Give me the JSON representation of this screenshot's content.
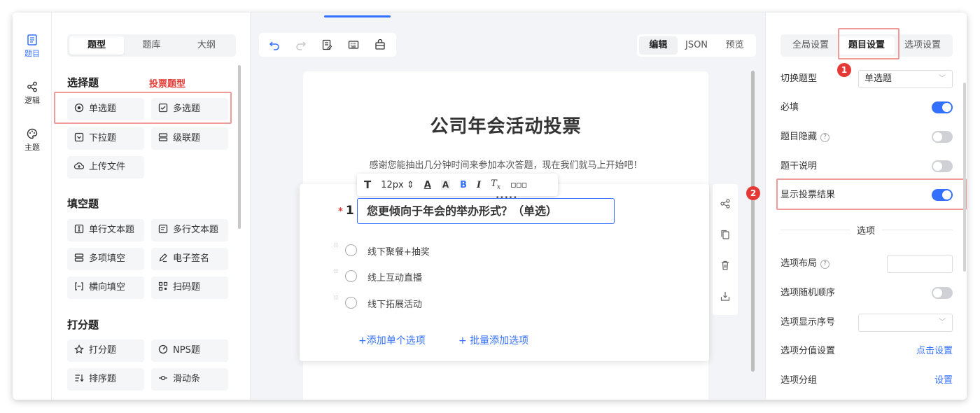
{
  "rail": [
    {
      "label": "题目",
      "icon": "document-icon",
      "active": true
    },
    {
      "label": "逻辑",
      "icon": "share-icon"
    },
    {
      "label": "主题",
      "icon": "palette-icon"
    }
  ],
  "left": {
    "tabs": [
      "题型",
      "题库",
      "大纲"
    ],
    "sections": {
      "choice": "选择题",
      "fill": "填空题",
      "score": "打分题"
    },
    "vote_label": "投票题型",
    "choice_items": [
      "单选题",
      "多选题",
      "下拉题",
      "级联题",
      "上传文件"
    ],
    "fill_items": [
      "单行文本题",
      "多行文本题",
      "多项填空",
      "电子签名",
      "横向填空",
      "扫码题"
    ],
    "score_items": [
      "打分题",
      "NPS题",
      "排序题",
      "滑动条"
    ]
  },
  "center": {
    "modes": [
      "编辑",
      "JSON",
      "预览"
    ],
    "survey_title": "公司年会活动投票",
    "survey_desc": "感谢您能抽出几分钟时间来参加本次答题，现在我们就马上开始吧！",
    "rt": {
      "font_size": "12px"
    },
    "question": {
      "number": "1",
      "title": "您更倾向于年会的举办形式？（单选）"
    },
    "options": [
      "线下聚餐+抽奖",
      "线上互动直播",
      "线下拓展活动"
    ],
    "add_single": "+添加单个选项",
    "add_batch": "+ 批量添加选项"
  },
  "right": {
    "tabs": [
      "全局设置",
      "题目设置",
      "选项设置"
    ],
    "switch_type": {
      "label": "切换题型",
      "value": "单选题"
    },
    "required": "必填",
    "hidden": "题目隐藏",
    "desc": "题干说明",
    "show_vote": "显示投票结果",
    "options_divider": "选项",
    "layout": "选项布局",
    "random": "选项随机顺序",
    "seq": "选项显示序号",
    "score": {
      "label": "选项分值设置",
      "link": "点击设置"
    },
    "group": {
      "label": "选项分组",
      "link": "设置"
    },
    "badge1": "1",
    "badge2": "2"
  },
  "colors": {
    "accent": "#3370ff",
    "annotation": "#e53935"
  }
}
